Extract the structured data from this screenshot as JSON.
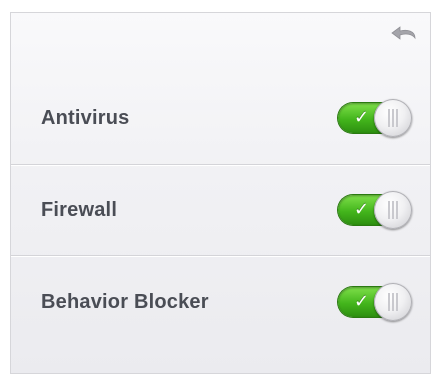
{
  "header": {
    "back_icon": "back-arrow-icon"
  },
  "colors": {
    "toggle_on": "#43b51c",
    "label_text": "#4a4d55"
  },
  "settings": [
    {
      "label": "Antivirus",
      "enabled": true,
      "check_glyph": "✓"
    },
    {
      "label": "Firewall",
      "enabled": true,
      "check_glyph": "✓"
    },
    {
      "label": "Behavior Blocker",
      "enabled": true,
      "check_glyph": "✓"
    }
  ]
}
